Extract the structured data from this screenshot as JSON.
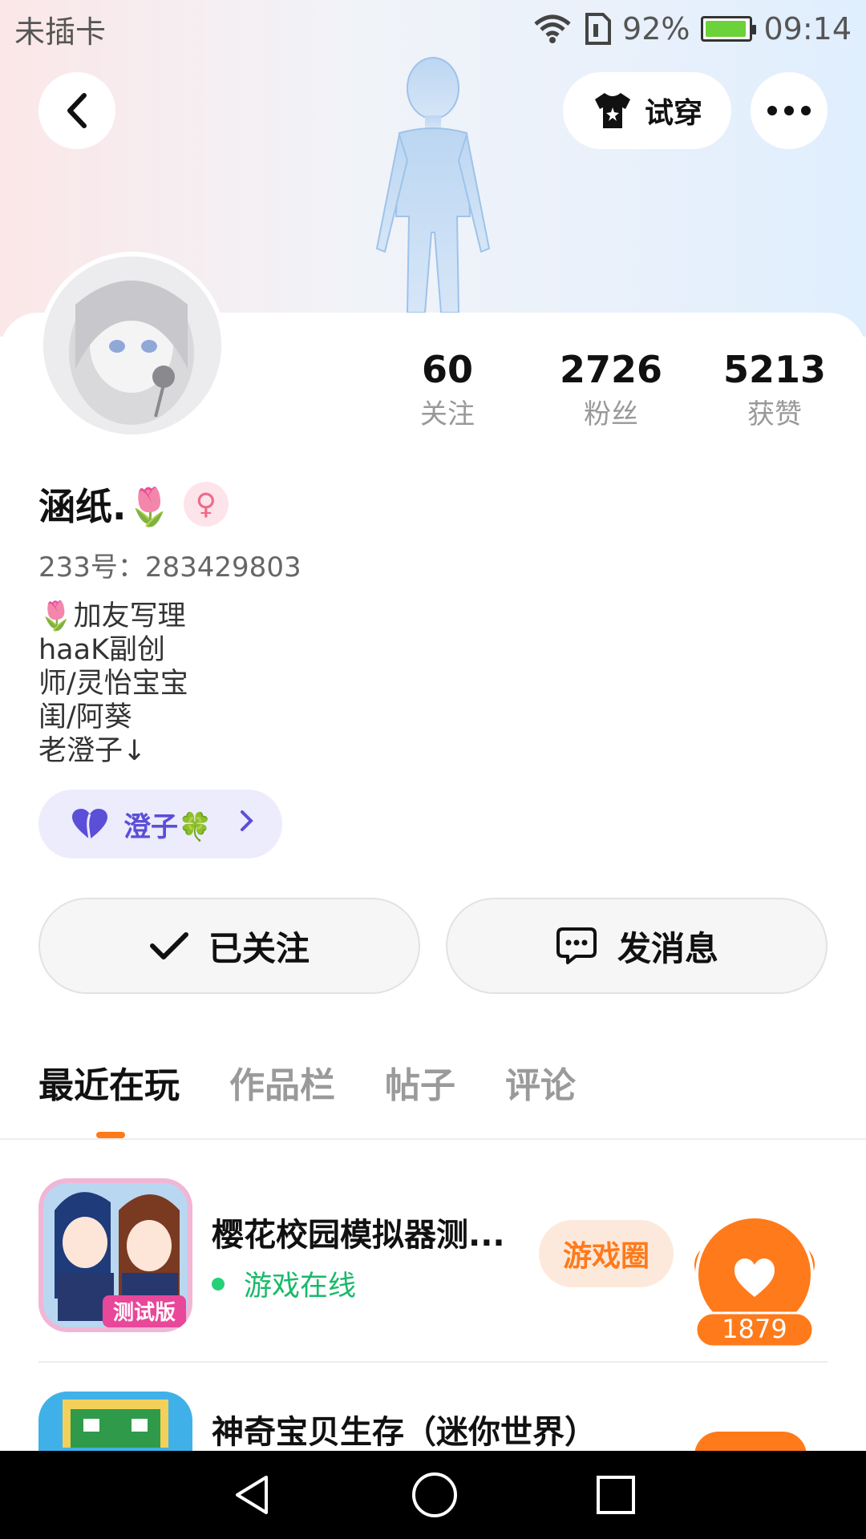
{
  "status_bar": {
    "carrier": "未插卡",
    "battery": "92%",
    "time": "09:14"
  },
  "header": {
    "tryon_label": "试穿"
  },
  "stats": [
    {
      "value": "60",
      "label": "关注"
    },
    {
      "value": "2726",
      "label": "粉丝"
    },
    {
      "value": "5213",
      "label": "获赞"
    }
  ],
  "profile": {
    "username": "涵纸.🌷",
    "gender_symbol": "♀",
    "uid": "233号：283429803",
    "bio_lines": [
      "🌷加友写理",
      "haaK副创",
      "师/灵怡宝宝",
      "闺/阿葵",
      "老澄子↓"
    ]
  },
  "group": {
    "label": "澄子🍀"
  },
  "actions": {
    "followed_label": "已关注",
    "message_label": "发消息"
  },
  "tabs": [
    "最近在玩",
    "作品栏",
    "帖子",
    "评论"
  ],
  "games": [
    {
      "title": "樱花校园模拟器测...",
      "status": "游戏在线",
      "circle_label": "游戏圈",
      "likes": "1879",
      "badge": "测试版"
    },
    {
      "title": "神奇宝贝生存（迷你世界）"
    }
  ],
  "colors": {
    "accent": "#ff7a1a",
    "online": "#19b96a",
    "group_text": "#5b4fd8",
    "gender_pink": "#f06a8a"
  },
  "icons": [
    "back-arrow-icon",
    "shirt-icon",
    "more-icon",
    "wifi-icon",
    "sim-icon",
    "battery-icon",
    "heart-icon",
    "clover-icon",
    "chevron-right-icon",
    "check-icon",
    "chat-icon",
    "nav-back-icon",
    "nav-home-icon",
    "nav-recents-icon"
  ]
}
